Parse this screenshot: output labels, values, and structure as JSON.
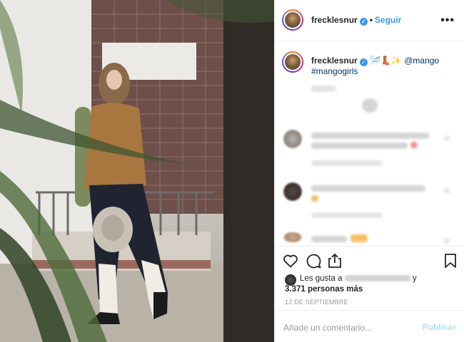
{
  "post": {
    "username": "frecklesnur",
    "follow_label": "Seguir",
    "more_label": "•••",
    "verified_mark": "✓"
  },
  "caption": {
    "username": "frecklesnur",
    "emojis": "🪡👢✨",
    "mention": "@mango",
    "hashtag": "#mangogirls"
  },
  "likes": {
    "prefix": "Les gusta a",
    "suffix": "y",
    "count": "3.371 personas más"
  },
  "date": "12 DE SEPTIEMBRE",
  "comment_box": {
    "placeholder": "Añade un comentario...",
    "publish_label": "Publicar"
  },
  "icons": {
    "like": "heart-icon",
    "comment": "comment-icon",
    "share": "share-icon",
    "save": "bookmark-icon",
    "more": "more-options-icon"
  },
  "colors": {
    "accent": "#3897f0",
    "link": "#003569",
    "publish_disabled": "#b2dffc"
  }
}
